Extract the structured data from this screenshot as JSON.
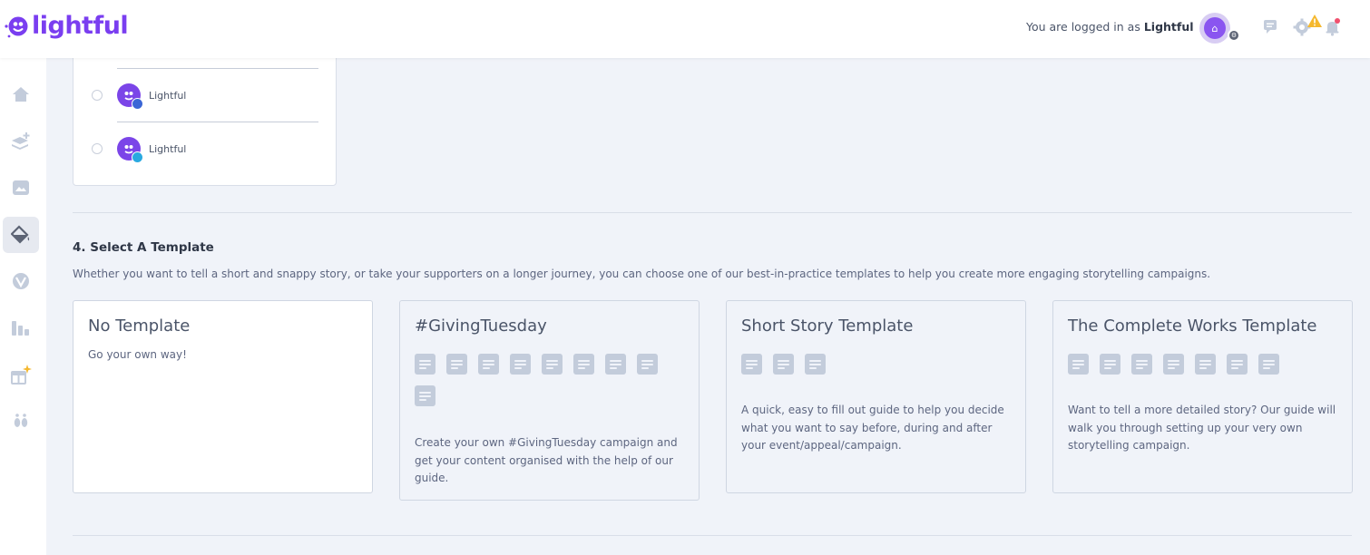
{
  "header": {
    "brand": "lightful",
    "login_prefix": "You are logged in as",
    "login_user": "Lightful",
    "colors": {
      "brand": "#7a3ef0",
      "warning": "#f5b82e",
      "alert_dot": "#f0506e"
    }
  },
  "sidebar": {
    "items": [
      {
        "icon": "home-icon"
      },
      {
        "icon": "layers-add-icon"
      },
      {
        "icon": "media-icon"
      },
      {
        "icon": "paint-bucket-icon",
        "active": true
      },
      {
        "icon": "vantage-icon"
      },
      {
        "icon": "analytics-icon"
      },
      {
        "icon": "gift-sparkle-icon"
      },
      {
        "icon": "footsteps-icon"
      }
    ]
  },
  "accounts": [
    {
      "name": "Lightful",
      "network": "facebook",
      "network_color": "#3b66d6"
    },
    {
      "name": "Lightful",
      "network": "twitter",
      "network_color": "#2aa9e0"
    }
  ],
  "template_section": {
    "title": "4. Select A Template",
    "description": "Whether you want to tell a short and snappy story, or take your supporters on a longer journey, you can choose one of our best-in-practice templates to help you create more engaging storytelling campaigns.",
    "templates": [
      {
        "title": "No Template",
        "subtitle": "Go your own way!",
        "icon_count": 0,
        "description": ""
      },
      {
        "title": "#GivingTuesday",
        "subtitle": "",
        "icon_count": 9,
        "description": "Create your own #GivingTuesday campaign and get your content organised with the help of our guide."
      },
      {
        "title": "Short Story Template",
        "subtitle": "",
        "icon_count": 3,
        "description": "A quick, easy to fill out guide to help you decide what you want to say before, during and after your event/appeal/campaign."
      },
      {
        "title": "The Complete Works Template",
        "subtitle": "",
        "icon_count": 7,
        "description": "Want to tell a more detailed story? Our guide will walk you through setting up your very own storytelling campaign."
      }
    ]
  }
}
